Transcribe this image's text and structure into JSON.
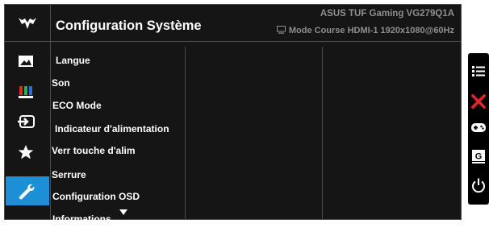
{
  "header": {
    "title": "Configuration Système",
    "model": "ASUS TUF Gaming VG279Q1A",
    "status": "Mode Course HDMI-1 1920x1080@60Hz"
  },
  "sidebar": {
    "items": [
      {
        "icon": "image-icon",
        "active": false
      },
      {
        "icon": "color-bars-icon",
        "active": false
      },
      {
        "icon": "input-source-icon",
        "active": false
      },
      {
        "icon": "star-icon",
        "active": false
      },
      {
        "icon": "wrench-icon",
        "active": true
      }
    ]
  },
  "menu": {
    "items": [
      "Langue",
      "Son",
      "ECO Mode",
      "Indicateur d'alimentation",
      "Verr touche d'alim",
      "Serrure",
      "Configuration OSD",
      "Informations"
    ]
  },
  "keys": [
    "menu-icon",
    "close-icon",
    "gamepad-icon",
    "gameplus-icon",
    "power-icon"
  ],
  "colors": {
    "accent": "#1c8fd6",
    "close": "#e8232a",
    "panel": "#151515"
  }
}
